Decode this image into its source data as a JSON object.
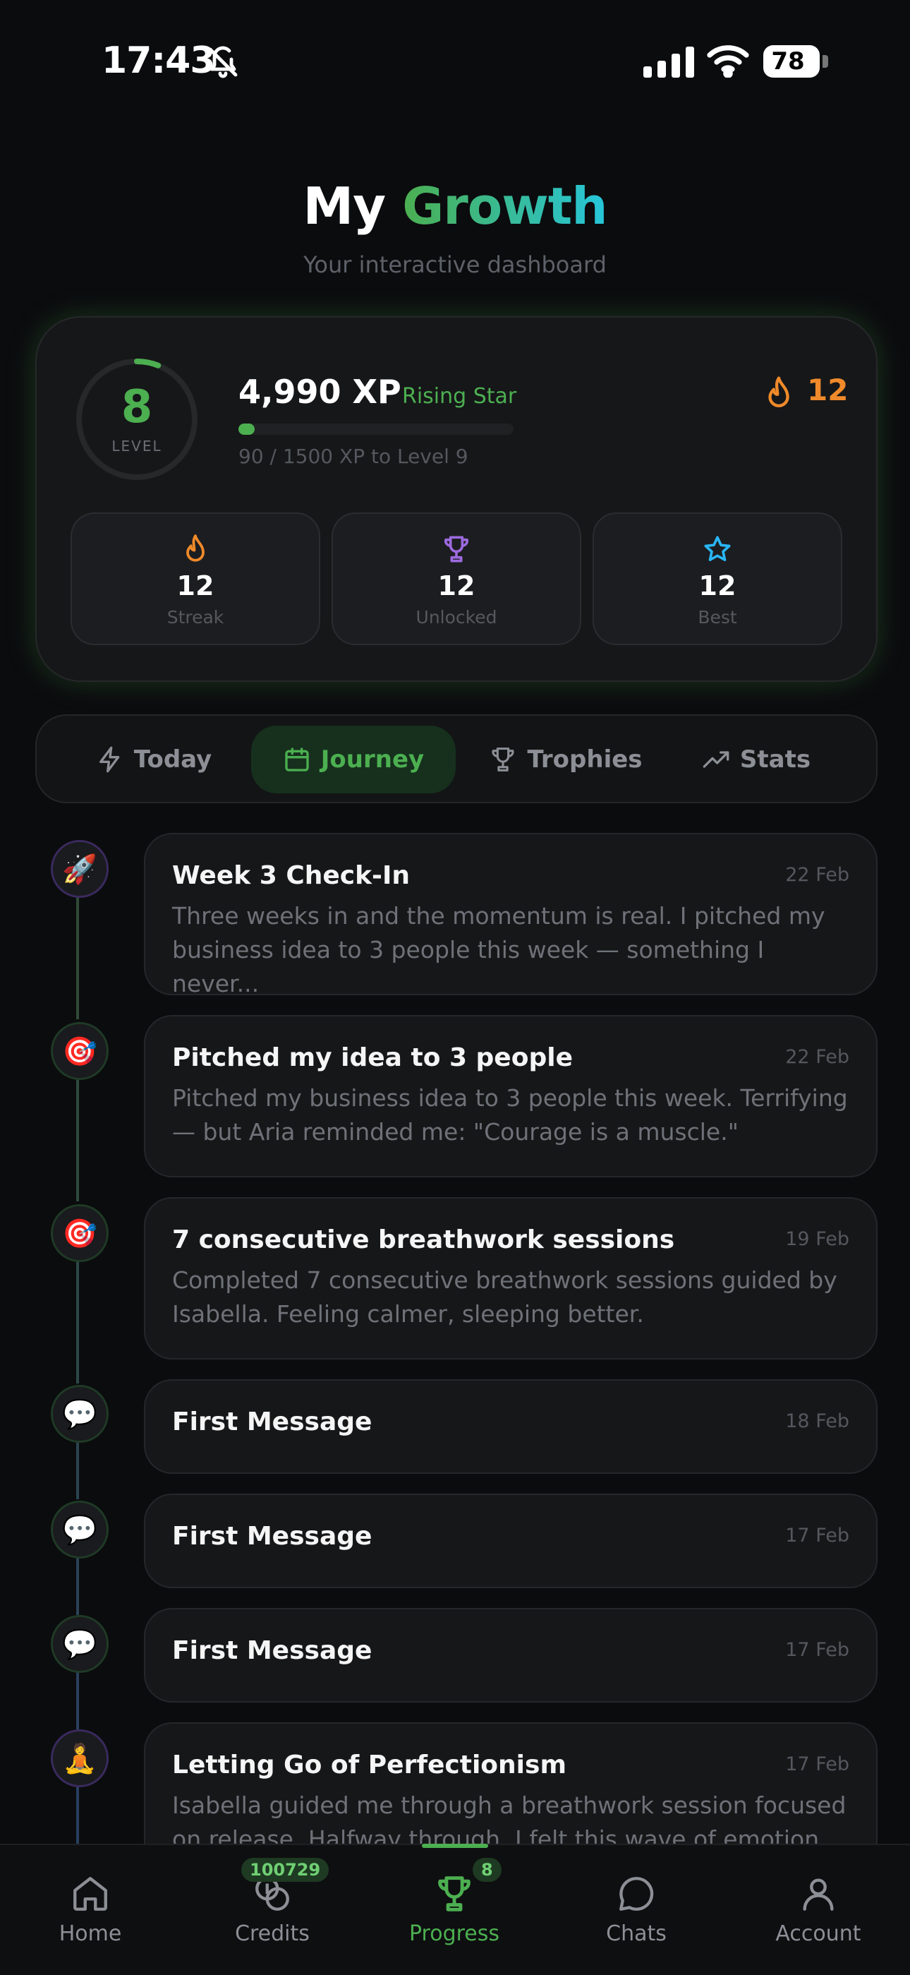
{
  "status_bar": {
    "time": "17:43",
    "battery": "78"
  },
  "header": {
    "title_part1": "My",
    "title_part2": "Growth",
    "subtitle": "Your interactive dashboard"
  },
  "level_card": {
    "level": "8",
    "level_label": "LEVEL",
    "level_progress_fraction": 0.06,
    "xp": "4,990 XP",
    "rank": "Rising Star",
    "xp_progress_fraction": 0.06,
    "xp_sub": "90 / 1500 XP to Level 9",
    "streak": "12",
    "stats": [
      {
        "icon": "flame-icon",
        "value": "12",
        "label": "Streak",
        "color": "#f08a2a"
      },
      {
        "icon": "trophy-icon",
        "value": "12",
        "label": "Unlocked",
        "color": "#9c6ade"
      },
      {
        "icon": "star-icon",
        "value": "12",
        "label": "Best",
        "color": "#29b6f6"
      }
    ]
  },
  "tabs": [
    {
      "label": "Today",
      "icon": "lightning-icon",
      "active": false
    },
    {
      "label": "Journey",
      "icon": "calendar-icon",
      "active": true
    },
    {
      "label": "Trophies",
      "icon": "trophy-icon",
      "active": false
    },
    {
      "label": "Stats",
      "icon": "trending-up-icon",
      "active": false
    }
  ],
  "timeline": [
    {
      "emoji": "🚀",
      "title": "Week 3 Check-In",
      "date": "22 Feb",
      "desc": "Three weeks in and the momentum is real. I pitched my business idea to 3 people this week — something I never..."
    },
    {
      "emoji": "🎯",
      "title": "Pitched my idea to 3 people",
      "date": "22 Feb",
      "desc": "Pitched my business idea to 3 people this week. Terrifying — but Aria reminded me: \"Courage is a muscle.\""
    },
    {
      "emoji": "🎯",
      "title": "7 consecutive breathwork sessions",
      "date": "19 Feb",
      "desc": "Completed 7 consecutive breathwork sessions guided by Isabella. Feeling calmer, sleeping better."
    },
    {
      "emoji": "💬",
      "title": "First Message",
      "date": "18 Feb",
      "desc": ""
    },
    {
      "emoji": "💬",
      "title": "First Message",
      "date": "17 Feb",
      "desc": ""
    },
    {
      "emoji": "💬",
      "title": "First Message",
      "date": "17 Feb",
      "desc": ""
    },
    {
      "emoji": "🧘",
      "title": "Letting Go of Perfectionism",
      "date": "17 Feb",
      "desc": "Isabella guided me through a breathwork session focused on release. Halfway through, I felt this wave of emotion — like..."
    }
  ],
  "bottom_nav": [
    {
      "label": "Home",
      "icon": "home-icon",
      "badge": ""
    },
    {
      "label": "Credits",
      "icon": "coins-icon",
      "badge": "100729"
    },
    {
      "label": "Progress",
      "icon": "trophy-icon",
      "badge": "8",
      "active": true
    },
    {
      "label": "Chats",
      "icon": "chat-bubble-icon",
      "badge": ""
    },
    {
      "label": "Account",
      "icon": "person-icon",
      "badge": ""
    }
  ]
}
